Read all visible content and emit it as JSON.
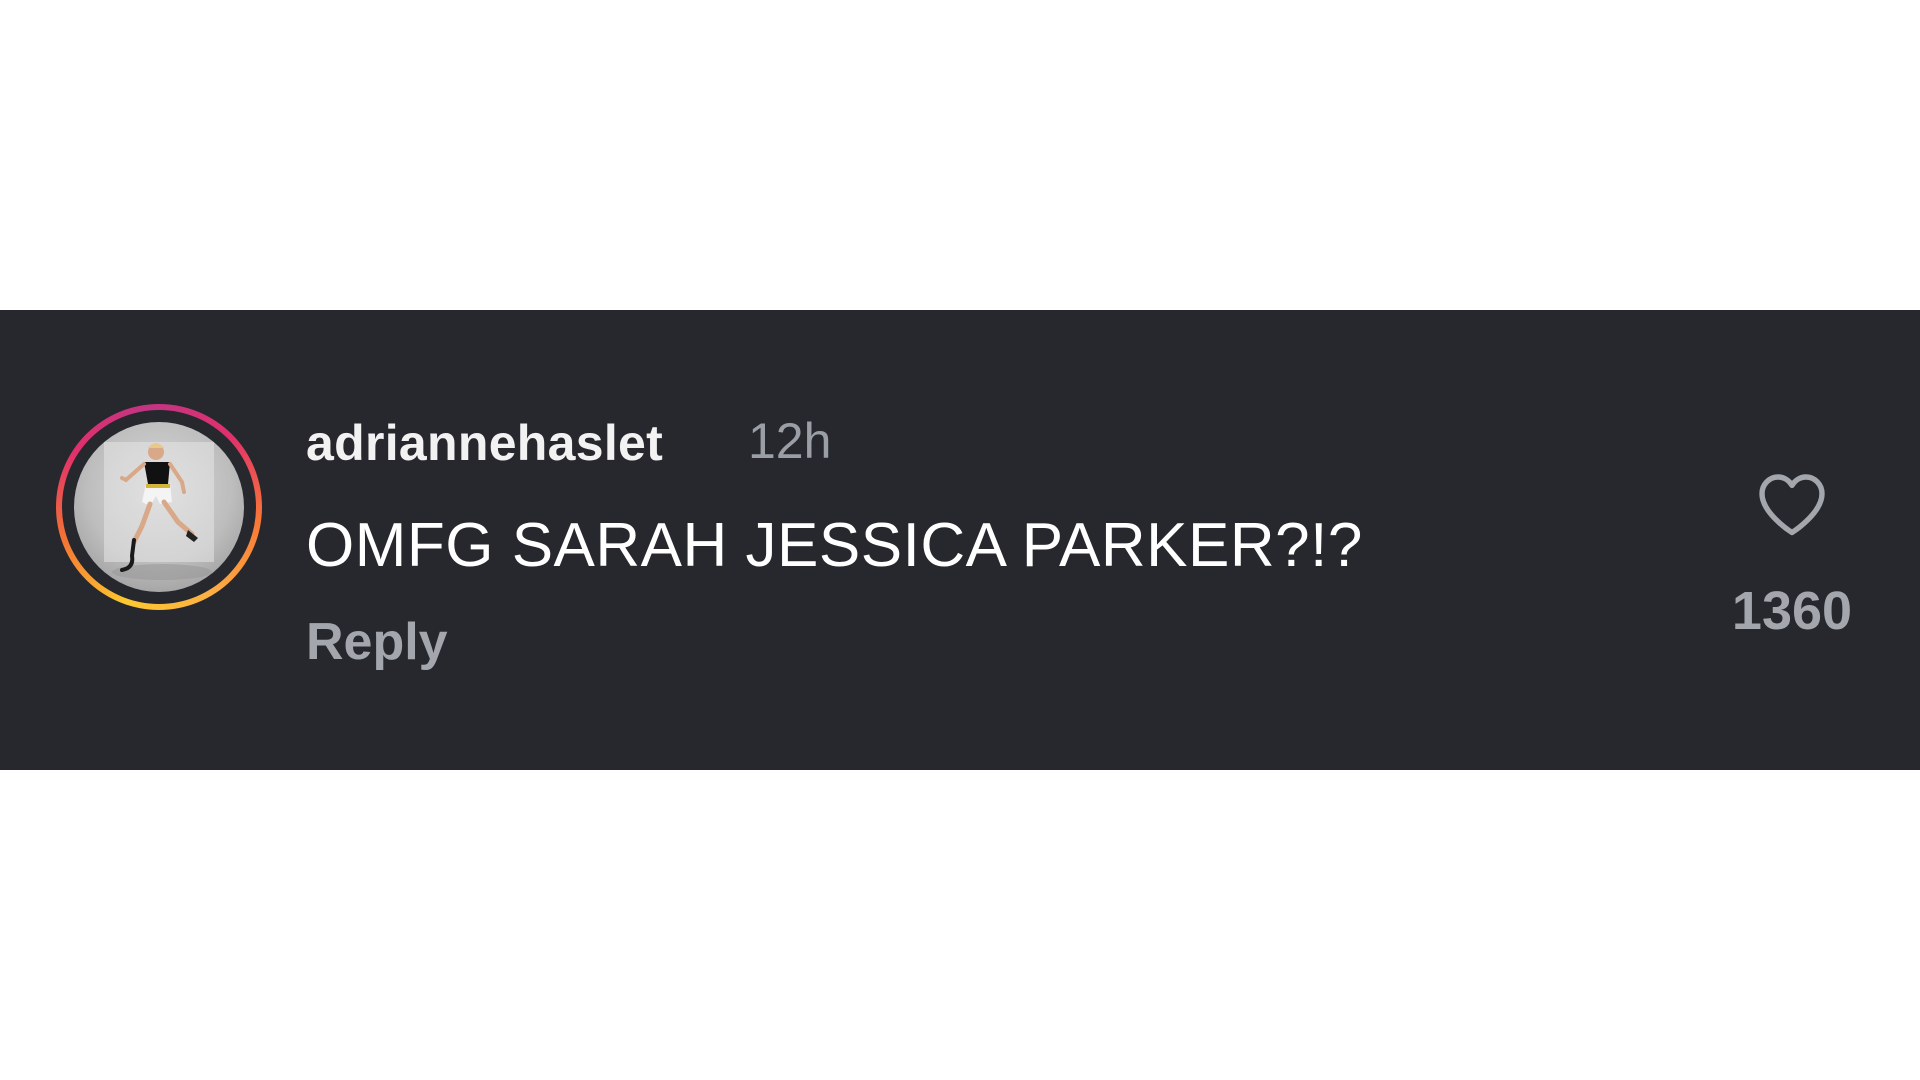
{
  "comment": {
    "username": "adriannehaslet",
    "timestamp": "12h",
    "text": "OMFG SARAH JESSICA PARKER?!?",
    "reply_label": "Reply",
    "like_count": "1360"
  },
  "avatar": {
    "icon": "user-avatar-photo",
    "story_ring": true
  },
  "icons": {
    "like": "heart-outline-icon"
  },
  "colors": {
    "card_background": "#26282d",
    "page_background": "#ffffff",
    "username": "#f2f2f2",
    "timestamp": "#9a9ea6",
    "comment_text": "#ffffff",
    "muted": "#a3a6ad",
    "ring_gradient": [
      "#fdc830",
      "#f37335",
      "#e1306c",
      "#c13584"
    ]
  }
}
